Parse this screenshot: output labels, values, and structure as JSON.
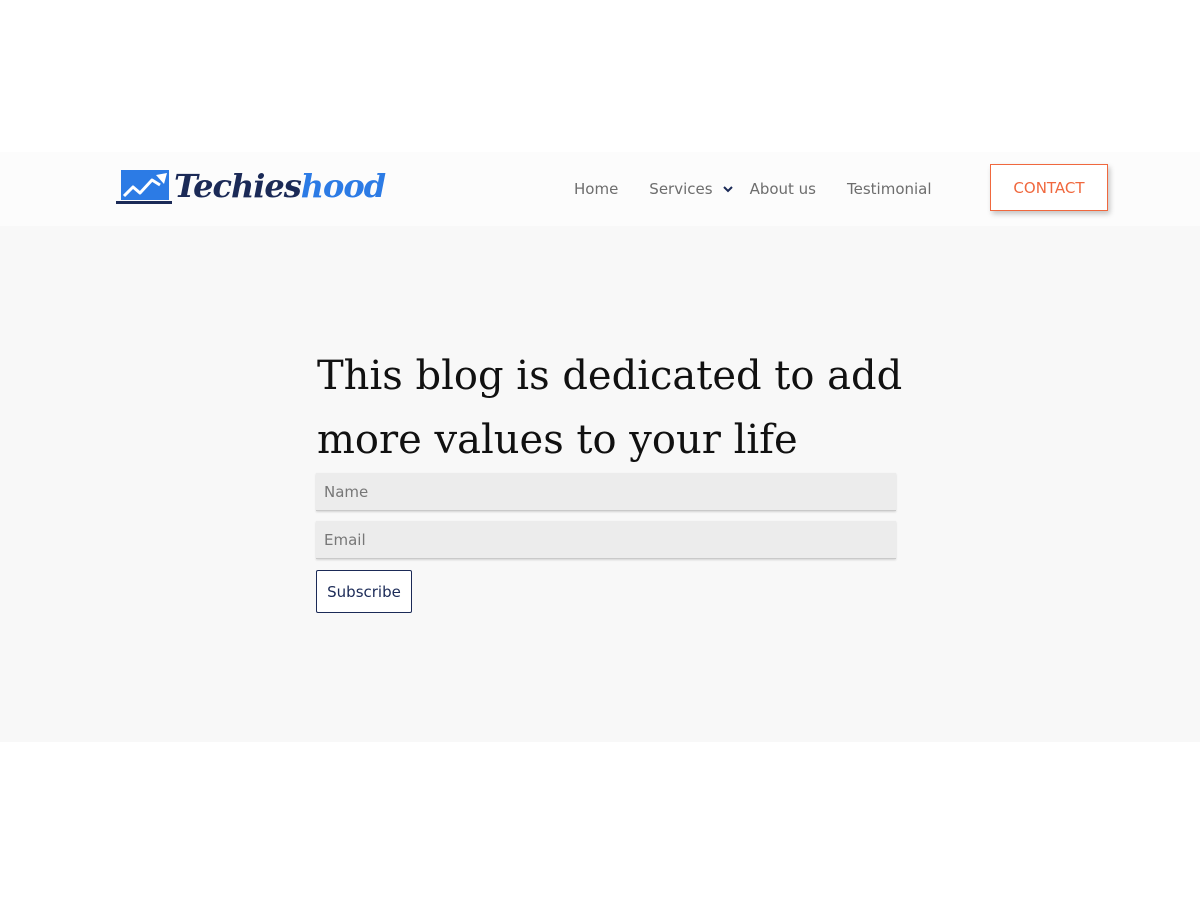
{
  "brand": {
    "name_part1": "Techies",
    "name_part2": "hood",
    "colors": {
      "dark": "#1b2a57",
      "accent": "#2c7be5"
    },
    "icon": "trending-up-chart-icon"
  },
  "nav": {
    "items": [
      {
        "label": "Home"
      },
      {
        "label": "Services",
        "has_dropdown": true,
        "icon": "chevron-down-icon"
      },
      {
        "label": "About us"
      },
      {
        "label": "Testimonial"
      }
    ],
    "contact_label": "CONTACT",
    "contact_color": "#f0683e"
  },
  "hero": {
    "headline": "This blog is dedicated to add more values to your life",
    "name_placeholder": "Name",
    "email_placeholder": "Email",
    "subscribe_label": "Subscribe"
  }
}
